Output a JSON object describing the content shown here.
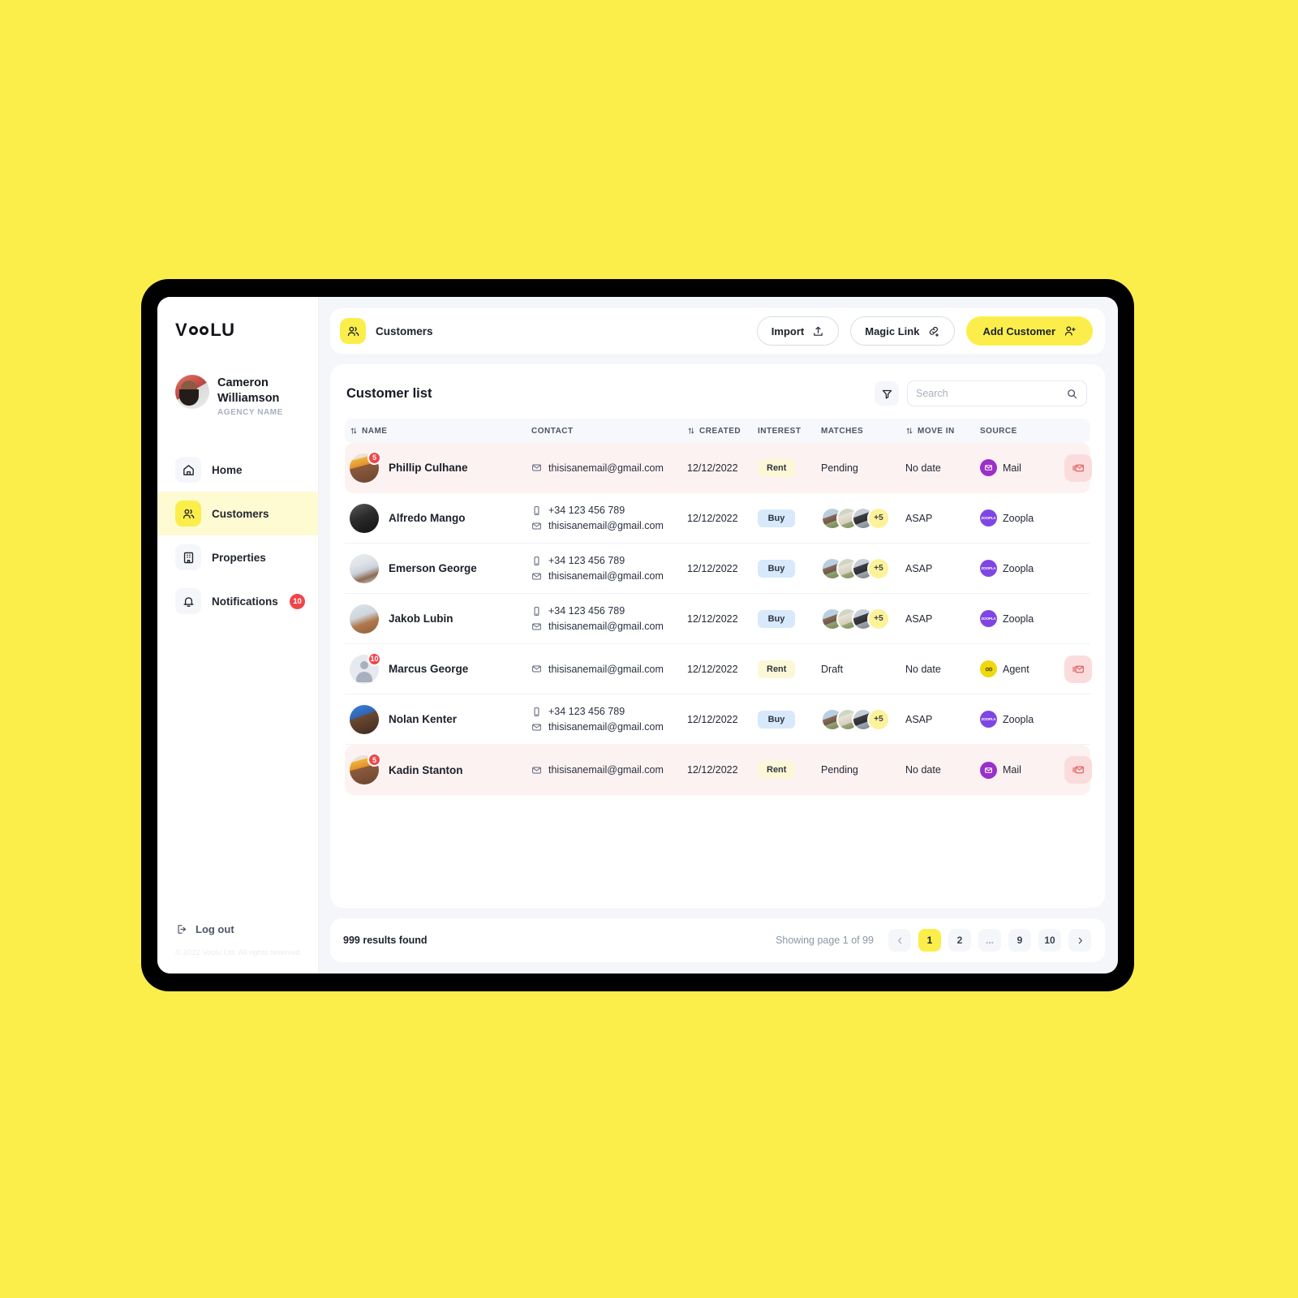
{
  "brand": {
    "logo_text": "VOOLU",
    "accent": "#FBEE4B"
  },
  "sidebar": {
    "profile": {
      "name": "Cameron Williamson",
      "agency": "AGENCY NAME"
    },
    "items": [
      {
        "label": "Home",
        "icon": "home-icon",
        "badge": ""
      },
      {
        "label": "Customers",
        "icon": "users-icon",
        "badge": ""
      },
      {
        "label": "Properties",
        "icon": "building-icon",
        "badge": ""
      },
      {
        "label": "Notifications",
        "icon": "bell-icon",
        "badge": "10"
      }
    ],
    "logout_label": "Log out",
    "logout_icon": "logout-icon",
    "copyright": "© 2022 Voolu Ltd. All rights reserved"
  },
  "topbar": {
    "breadcrumb": "Customers",
    "breadcrumb_icon": "users-icon",
    "import_label": "Import",
    "import_icon": "upload-icon",
    "magic_link_label": "Magic Link",
    "magic_link_icon": "link-icon",
    "add_customer_label": "Add Customer",
    "add_customer_icon": "user-plus-icon"
  },
  "list": {
    "title": "Customer list",
    "filter_icon": "filter-icon",
    "search": {
      "placeholder": "Search",
      "value": "",
      "icon": "search-icon"
    },
    "columns": [
      {
        "label": "NAME",
        "sortable": true
      },
      {
        "label": "CONTACT",
        "sortable": false
      },
      {
        "label": "CREATED",
        "sortable": true
      },
      {
        "label": "INTEREST",
        "sortable": false
      },
      {
        "label": "MATCHES",
        "sortable": false
      },
      {
        "label": "MOVE IN",
        "sortable": true
      },
      {
        "label": "SOURCE",
        "sortable": false
      }
    ],
    "rows": [
      {
        "name": "Phillip Culhane",
        "avatar_badge": "5",
        "avatar_type": "photo-turban",
        "phone": "",
        "email": "thisisanemail@gmail.com",
        "created": "12/12/2022",
        "interest": "Rent",
        "interest_type": "rent",
        "matches_text": "Pending",
        "matches_type": "text",
        "move_in": "No date",
        "source": "Mail",
        "source_icon": "mail-badge-icon",
        "alert": true,
        "action_icon": "unread-mail-icon"
      },
      {
        "name": "Alfredo Mango",
        "avatar_badge": "",
        "avatar_type": "photo-dark",
        "phone": "+34 123 456 789",
        "email": "thisisanemail@gmail.com",
        "created": "12/12/2022",
        "interest": "Buy",
        "interest_type": "buy",
        "matches_text": "+5",
        "matches_type": "stack",
        "move_in": "ASAP",
        "source": "Zoopla",
        "source_icon": "zoopla-badge-icon",
        "alert": false,
        "action_icon": ""
      },
      {
        "name": "Emerson George",
        "avatar_badge": "",
        "avatar_type": "photo-light",
        "phone": "+34 123 456 789",
        "email": "thisisanemail@gmail.com",
        "created": "12/12/2022",
        "interest": "Buy",
        "interest_type": "buy",
        "matches_text": "+5",
        "matches_type": "stack",
        "move_in": "ASAP",
        "source": "Zoopla",
        "source_icon": "zoopla-badge-icon",
        "alert": false,
        "action_icon": ""
      },
      {
        "name": "Jakob Lubin",
        "avatar_badge": "",
        "avatar_type": "photo-snow",
        "phone": "+34 123 456 789",
        "email": "thisisanemail@gmail.com",
        "created": "12/12/2022",
        "interest": "Buy",
        "interest_type": "buy",
        "matches_text": "+5",
        "matches_type": "stack",
        "move_in": "ASAP",
        "source": "Zoopla",
        "source_icon": "zoopla-badge-icon",
        "alert": false,
        "action_icon": ""
      },
      {
        "name": "Marcus George",
        "avatar_badge": "10",
        "avatar_type": "placeholder",
        "phone": "",
        "email": "thisisanemail@gmail.com",
        "created": "12/12/2022",
        "interest": "Rent",
        "interest_type": "rent",
        "matches_text": "Draft",
        "matches_type": "text",
        "move_in": "No date",
        "source": "Agent",
        "source_icon": "agent-badge-icon",
        "alert": false,
        "action_icon": "unread-mail-icon"
      },
      {
        "name": "Nolan Kenter",
        "avatar_badge": "",
        "avatar_type": "photo-blue",
        "phone": "+34 123 456 789",
        "email": "thisisanemail@gmail.com",
        "created": "12/12/2022",
        "interest": "Buy",
        "interest_type": "buy",
        "matches_text": "+5",
        "matches_type": "stack",
        "move_in": "ASAP",
        "source": "Zoopla",
        "source_icon": "zoopla-badge-icon",
        "alert": false,
        "action_icon": ""
      },
      {
        "name": "Kadin Stanton",
        "avatar_badge": "5",
        "avatar_type": "photo-turban",
        "phone": "",
        "email": "thisisanemail@gmail.com",
        "created": "12/12/2022",
        "interest": "Rent",
        "interest_type": "rent",
        "matches_text": "Pending",
        "matches_type": "text",
        "move_in": "No date",
        "source": "Mail",
        "source_icon": "mail-badge-icon",
        "alert": true,
        "action_icon": "unread-mail-icon"
      }
    ]
  },
  "footer": {
    "results": "999 results found",
    "showing": "Showing page 1 of 99",
    "pages": [
      "1",
      "2",
      "...",
      "9",
      "10"
    ],
    "current_page": "1",
    "prev_icon": "chevron-left-icon",
    "next_icon": "chevron-right-icon"
  }
}
